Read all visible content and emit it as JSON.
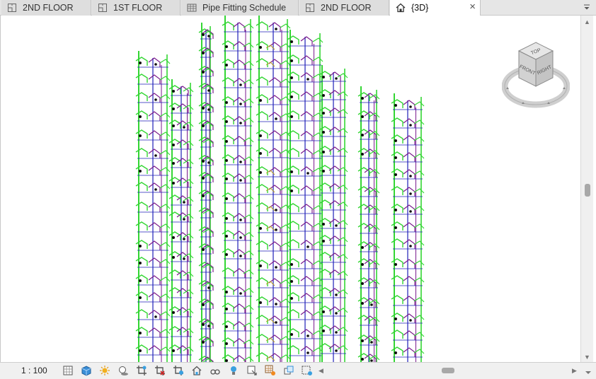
{
  "tabs": [
    {
      "label": "2ND FLOOR",
      "icon": "floor-plan-icon",
      "active": false
    },
    {
      "label": "1ST FLOOR",
      "icon": "floor-plan-icon",
      "active": false
    },
    {
      "label": "Pipe Fitting Schedule",
      "icon": "schedule-icon",
      "active": false
    },
    {
      "label": "2ND FLOOR",
      "icon": "floor-plan-icon",
      "active": false
    },
    {
      "label": "{3D}",
      "icon": "home-3d-icon",
      "active": true,
      "close": "×"
    }
  ],
  "viewcube": {
    "top": "TOP",
    "front": "FRONT",
    "right": "RIGHT"
  },
  "status": {
    "scale": "1 : 100",
    "icons": [
      "detail-level-icon",
      "visual-style-icon",
      "sun-path-icon",
      "shadows-icon",
      "crop-view-icon",
      "show-crop-region-icon",
      "unlock-3d-view-icon",
      "temporary-hide-icon",
      "reveal-hidden-icon",
      "worksharing-icon",
      "analytical-model-icon",
      "highlight-displacement-icon",
      "reveal-constraints-icon",
      "temporary-view-properties-icon",
      "hide-analytical-icon"
    ]
  },
  "colors": {
    "pipe_green": "#33d633",
    "pipe_blue": "#1f1fb8",
    "pipe_purple": "#7a1a8c",
    "pipe_black": "#101010",
    "pipe_yellow": "#b8a020"
  }
}
